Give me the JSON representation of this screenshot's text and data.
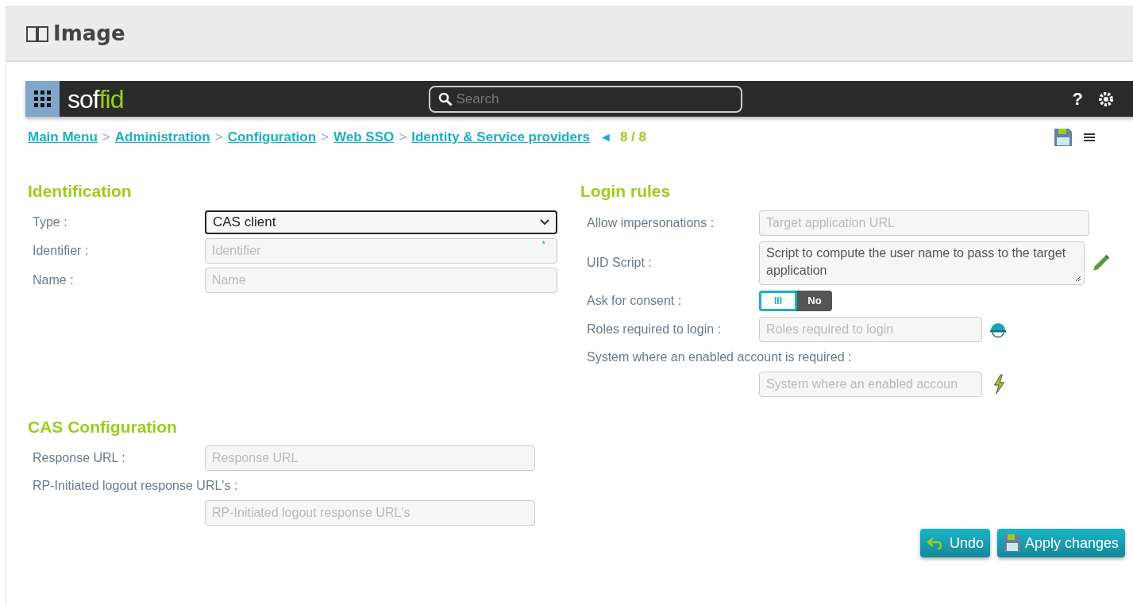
{
  "panel": {
    "title": "Image"
  },
  "topbar": {
    "logo_left": "sof",
    "logo_right": "fid",
    "search_placeholder": "Search",
    "help": "?"
  },
  "breadcrumb": {
    "items": [
      "Main Menu",
      "Administration",
      "Configuration",
      "Web SSO",
      "Identity & Service providers"
    ],
    "separator": ">",
    "prev": "◄",
    "position": "8 / 8"
  },
  "identification": {
    "title": "Identification",
    "fields": [
      {
        "label": "Type :",
        "kind": "select",
        "value": "CAS client"
      },
      {
        "label": "Identifier :",
        "kind": "input",
        "placeholder": "Identifier",
        "required": true,
        "required_mark": "*"
      },
      {
        "label": "Name :",
        "kind": "input",
        "placeholder": "Name"
      }
    ]
  },
  "login_rules": {
    "title": "Login rules",
    "fields": [
      {
        "label": "Allow impersonations :",
        "kind": "input",
        "placeholder": "Target application URL"
      },
      {
        "label": "UID Script :",
        "kind": "textarea",
        "placeholder": "Script to compute the user name to pass to the target application"
      },
      {
        "label": "Ask for consent :",
        "kind": "toggle",
        "on": false,
        "handle": "III",
        "off_label": "No"
      },
      {
        "label": "Roles required to login :",
        "kind": "input",
        "placeholder": "Roles required to login"
      },
      {
        "label": "System where an enabled account is required :",
        "kind": "input_below",
        "placeholder": "System where an enabled accoun"
      }
    ]
  },
  "cas": {
    "title": "CAS Configuration",
    "fields": [
      {
        "label": "Response URL :",
        "kind": "input",
        "placeholder": "Response URL"
      },
      {
        "label": "RP-Initiated logout response URL's :",
        "kind": "input_below",
        "placeholder": "RP-Initiated logout response URL's"
      }
    ]
  },
  "buttons": [
    {
      "label": "Undo",
      "kind": "undo"
    },
    {
      "label": "Apply changes",
      "kind": "apply"
    }
  ]
}
